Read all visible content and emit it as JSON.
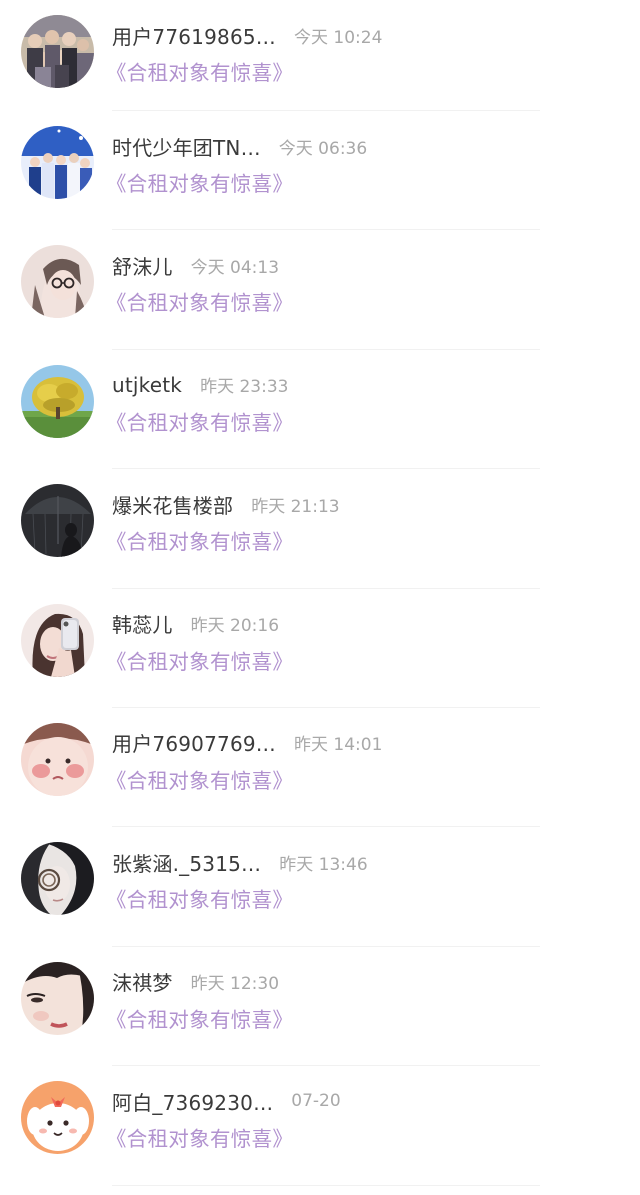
{
  "conversations": [
    {
      "name": "用户77619865…",
      "time": "今天 10:24",
      "message": "《合租对象有惊喜》",
      "avatar_icon": "group-photo-avatar",
      "avatar_colors": [
        "#c7b8a6",
        "#6e6a73"
      ]
    },
    {
      "name": "时代少年团TN…",
      "time": "今天 06:36",
      "message": "《合租对象有惊喜》",
      "avatar_icon": "band-photo-avatar",
      "avatar_colors": [
        "#3d69c8",
        "#e9eefb"
      ]
    },
    {
      "name": "舒沫儿",
      "time": "今天 04:13",
      "message": "《合租对象有惊喜》",
      "avatar_icon": "girl-glasses-avatar",
      "avatar_colors": [
        "#eadcd8",
        "#6b5a56"
      ]
    },
    {
      "name": "utjketk",
      "time": "昨天 23:33",
      "message": "《合租对象有惊喜》",
      "avatar_icon": "tree-landscape-avatar",
      "avatar_colors": [
        "#8ec3e6",
        "#d9c23a"
      ]
    },
    {
      "name": "爆米花售楼部",
      "time": "昨天 21:13",
      "message": "《合租对象有惊喜》",
      "avatar_icon": "umbrella-silhouette-avatar",
      "avatar_colors": [
        "#2a2b2f",
        "#5a5d63"
      ]
    },
    {
      "name": "韩蕊儿",
      "time": "昨天 20:16",
      "message": "《合租对象有惊喜》",
      "avatar_icon": "girl-phone-avatar",
      "avatar_colors": [
        "#f0e5e3",
        "#4a3330"
      ]
    },
    {
      "name": "用户76907769…",
      "time": "昨天 14:01",
      "message": "《合租对象有惊喜》",
      "avatar_icon": "blush-face-avatar",
      "avatar_colors": [
        "#f4d2ca",
        "#e58d8d"
      ]
    },
    {
      "name": "张紫涵._5315…",
      "time": "昨天 13:46",
      "message": "《合租对象有惊喜》",
      "avatar_icon": "dark-portrait-avatar",
      "avatar_colors": [
        "#1e1e22",
        "#e8e4e2"
      ]
    },
    {
      "name": "沫祺梦",
      "time": "昨天 12:30",
      "message": "《合租对象有惊喜》",
      "avatar_icon": "face-closeup-avatar",
      "avatar_colors": [
        "#f2ded5",
        "#2b2222"
      ]
    },
    {
      "name": "阿白_7369230…",
      "time": "07-20",
      "message": "《合租对象有惊喜》",
      "avatar_icon": "cartoon-dog-avatar",
      "avatar_colors": [
        "#f5a06a",
        "#ffffff"
      ]
    }
  ]
}
